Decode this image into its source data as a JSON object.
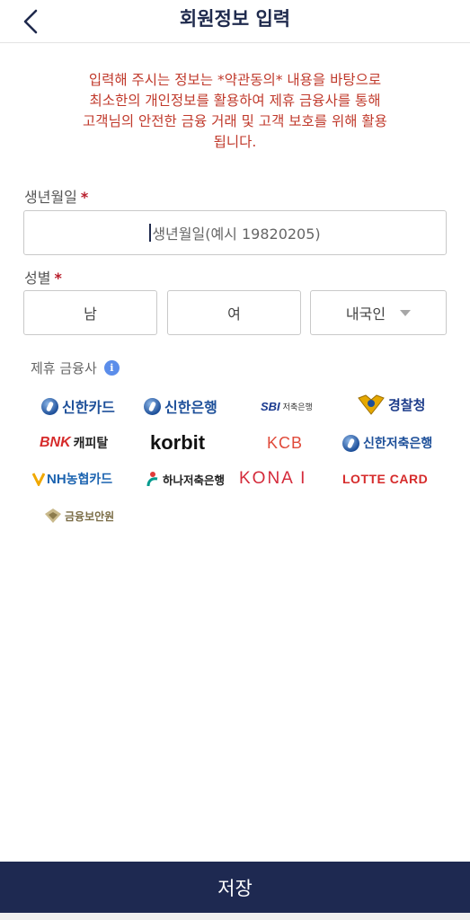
{
  "header": {
    "title": "회원정보 입력"
  },
  "notice": "입력해 주시는 정보는 *약관동의* 내용을 바탕으로\n최소한의 개인정보를 활용하여 제휴 금융사를 통해\n고객님의 안전한 금융 거래 및 고객 보호를 위해 활용\n됩니다.",
  "birth": {
    "label": "생년월일",
    "required_mark": "*",
    "placeholder": "생년월일(예시 19820205)"
  },
  "gender": {
    "label": "성별",
    "required_mark": "*",
    "male": "남",
    "female": "여",
    "nationality": "내국인"
  },
  "partners": {
    "label": "제휴 금융사",
    "info_icon": "i",
    "logos": [
      {
        "name": "신한카드"
      },
      {
        "name": "신한은행"
      },
      {
        "sbi": "SBI",
        "sub": "저축은행"
      },
      {
        "name": "경찰청"
      },
      {
        "bnk": "BNK",
        "sub": "캐피탈"
      },
      {
        "name": "korbit"
      },
      {
        "name": "KCB"
      },
      {
        "name": "신한저축은행"
      },
      {
        "nh": "NH",
        "sub": "농협카드"
      },
      {
        "name": "하나저축은행"
      },
      {
        "name": "KONA I"
      },
      {
        "name": "LOTTE CARD"
      },
      {
        "name": "금융보안원"
      }
    ]
  },
  "footer": {
    "save_label": "저장"
  },
  "colors": {
    "navy": "#1e2951",
    "notice_red": "#c0392b",
    "required_red": "#b81c2a",
    "info_blue": "#5b8dea"
  }
}
